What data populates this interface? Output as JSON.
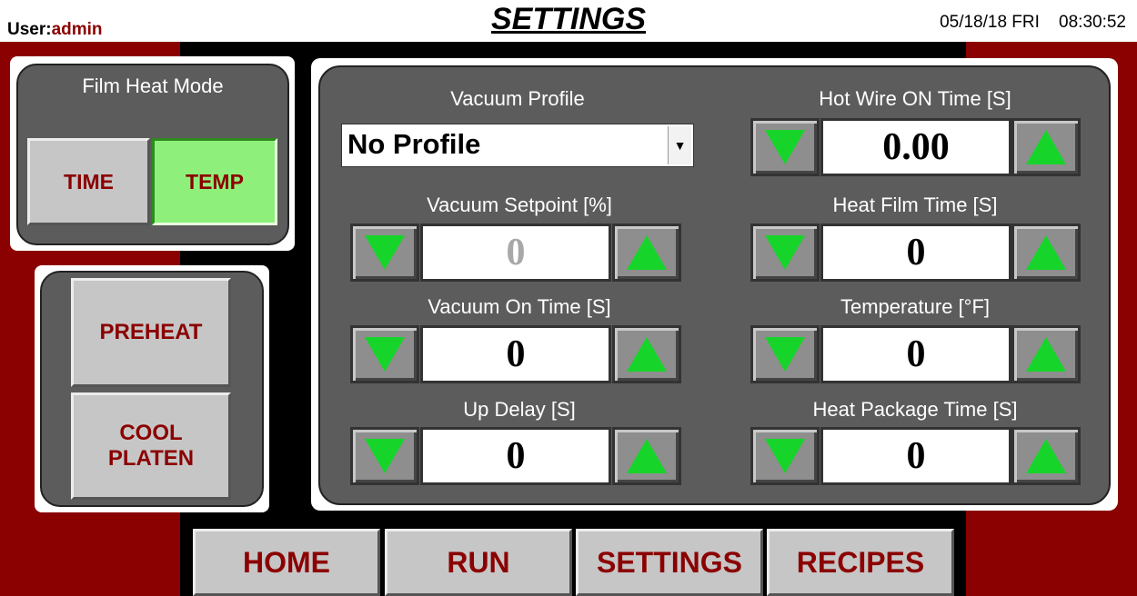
{
  "header": {
    "user_label": "User:",
    "user_name": "admin",
    "title": "SETTINGS",
    "date": "05/18/18 FRI",
    "time": "08:30:52"
  },
  "film_heat_mode": {
    "title": "Film Heat Mode",
    "time_label": "TIME",
    "temp_label": "TEMP",
    "active": "TEMP"
  },
  "actions": {
    "preheat_label": "PREHEAT",
    "cool_platen_label": "COOL PLATEN"
  },
  "vacuum_profile": {
    "label": "Vacuum Profile",
    "selected": "No Profile"
  },
  "fields": {
    "vacuum_setpoint": {
      "label": "Vacuum Setpoint [%]",
      "value": "0"
    },
    "vacuum_on_time": {
      "label": "Vacuum On Time [S]",
      "value": "0"
    },
    "up_delay": {
      "label": "Up Delay [S]",
      "value": "0"
    },
    "hot_wire_on_time": {
      "label": "Hot Wire ON Time [S]",
      "value": "0.00"
    },
    "heat_film_time": {
      "label": "Heat Film Time [S]",
      "value": "0"
    },
    "temperature": {
      "label": "Temperature [°F]",
      "value": "0"
    },
    "heat_package_time": {
      "label": "Heat Package Time [S]",
      "value": "0"
    }
  },
  "nav": {
    "home": "HOME",
    "run": "RUN",
    "settings": "SETTINGS",
    "recipes": "RECIPES"
  },
  "colors": {
    "maroon": "#8b0000",
    "panel_gray": "#5c5c5c",
    "active_green": "#8ef07a",
    "arrow_green": "#17d42a"
  }
}
